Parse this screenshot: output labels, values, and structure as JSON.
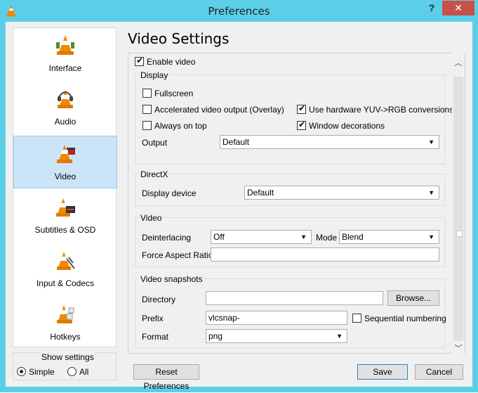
{
  "window": {
    "title": "Preferences",
    "help_glyph": "?",
    "close_glyph": "✕"
  },
  "sidebar": {
    "items": [
      {
        "label": "Interface",
        "icon": "cone-interface-icon"
      },
      {
        "label": "Audio",
        "icon": "cone-headphones-icon"
      },
      {
        "label": "Video",
        "icon": "cone-video-icon",
        "selected": true
      },
      {
        "label": "Subtitles & OSD",
        "icon": "cone-subtitles-icon"
      },
      {
        "label": "Input & Codecs",
        "icon": "cone-codecs-icon"
      },
      {
        "label": "Hotkeys",
        "icon": "cone-hotkeys-icon"
      }
    ],
    "show_settings": {
      "label": "Show settings",
      "simple": "Simple",
      "all": "All",
      "selected": "Simple"
    }
  },
  "main": {
    "heading": "Video Settings",
    "enable_video": {
      "label": "Enable video",
      "checked": true
    },
    "display": {
      "title": "Display",
      "fullscreen": {
        "label": "Fullscreen",
        "checked": false
      },
      "accel": {
        "label": "Accelerated video output (Overlay)",
        "checked": false
      },
      "on_top": {
        "label": "Always on top",
        "checked": false
      },
      "yuv": {
        "label": "Use hardware YUV->RGB conversions",
        "checked": true
      },
      "decorations": {
        "label": "Window decorations",
        "checked": true
      },
      "output_label": "Output",
      "output_value": "Default"
    },
    "directx": {
      "title": "DirectX",
      "device_label": "Display device",
      "device_value": "Default"
    },
    "video": {
      "title": "Video",
      "deinterlacing_label": "Deinterlacing",
      "deinterlacing_value": "Off",
      "mode_label": "Mode",
      "mode_value": "Blend",
      "aspect_label": "Force Aspect Ratio",
      "aspect_value": ""
    },
    "snapshots": {
      "title": "Video snapshots",
      "directory_label": "Directory",
      "directory_value": "",
      "browse": "Browse...",
      "prefix_label": "Prefix",
      "prefix_value": "vlcsnap-",
      "sequential": {
        "label": "Sequential numbering",
        "checked": false
      },
      "format_label": "Format",
      "format_value": "png"
    }
  },
  "buttons": {
    "reset": "Reset Preferences",
    "save": "Save",
    "cancel": "Cancel"
  },
  "colors": {
    "titlebar": "#5ccfe8",
    "close": "#c7504a",
    "selected": "#cce4f7"
  }
}
